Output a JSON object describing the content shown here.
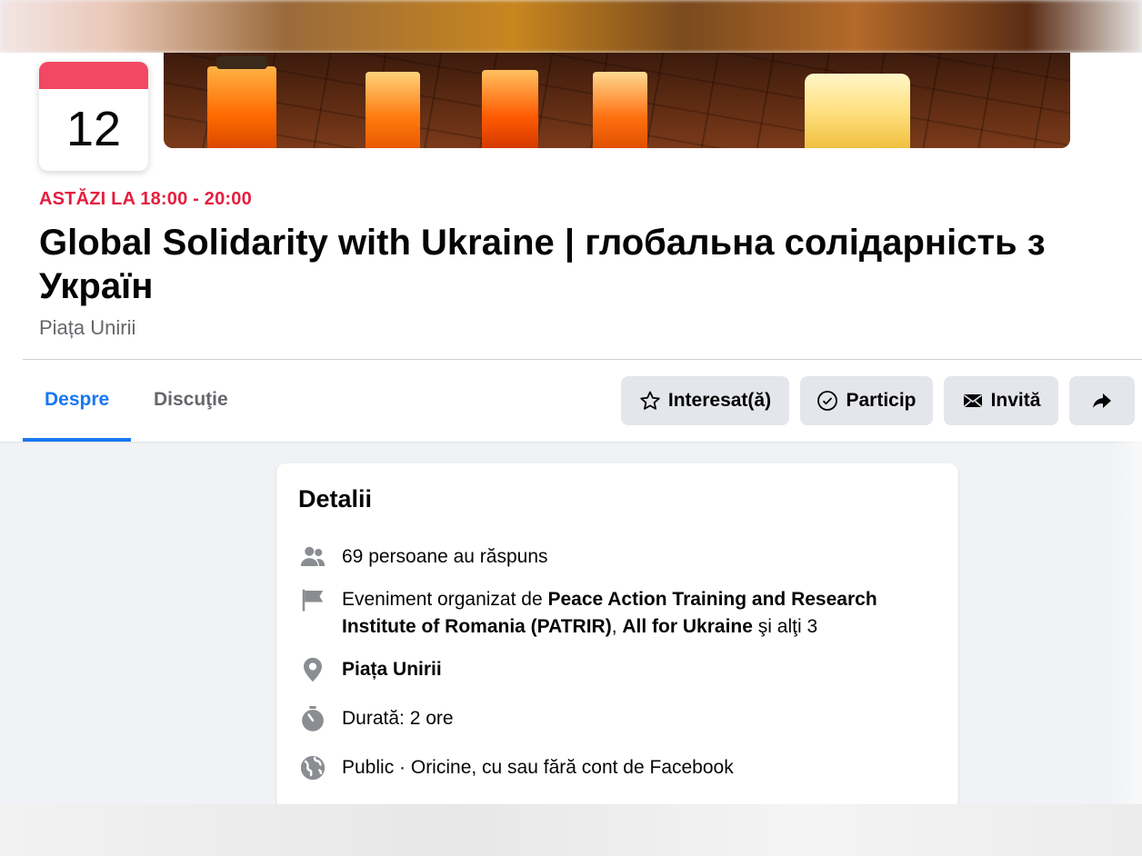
{
  "calendar": {
    "day": "12"
  },
  "event": {
    "when": "ASTĂZI LA 18:00 - 20:00",
    "title": "Global Solidarity with Ukraine | глобальна солідарність з Україн",
    "location": "Piața Unirii"
  },
  "tabs": [
    {
      "label": "Despre",
      "active": true
    },
    {
      "label": "Discuţie",
      "active": false
    }
  ],
  "actions": {
    "interested": "Interesat(ă)",
    "going": "Particip",
    "invite": "Invită",
    "share_icon": "share-icon"
  },
  "details": {
    "heading": "Detalii",
    "responses": "69 persoane au răspuns",
    "organized_prefix": "Eveniment organizat de ",
    "organizer1": "Peace Action Training and Research Institute of Romania (PATRIR)",
    "organizer_sep": ", ",
    "organizer2": "All for Ukraine",
    "organized_suffix": " şi alţi 3",
    "place": "Piața Unirii",
    "duration": "Durată: 2 ore",
    "privacy": "Public · Oricine, cu sau fără cont de Facebook"
  },
  "colors": {
    "accent": "#1877f2",
    "date_red": "#e41e3f",
    "calendar_header": "#f02849"
  }
}
